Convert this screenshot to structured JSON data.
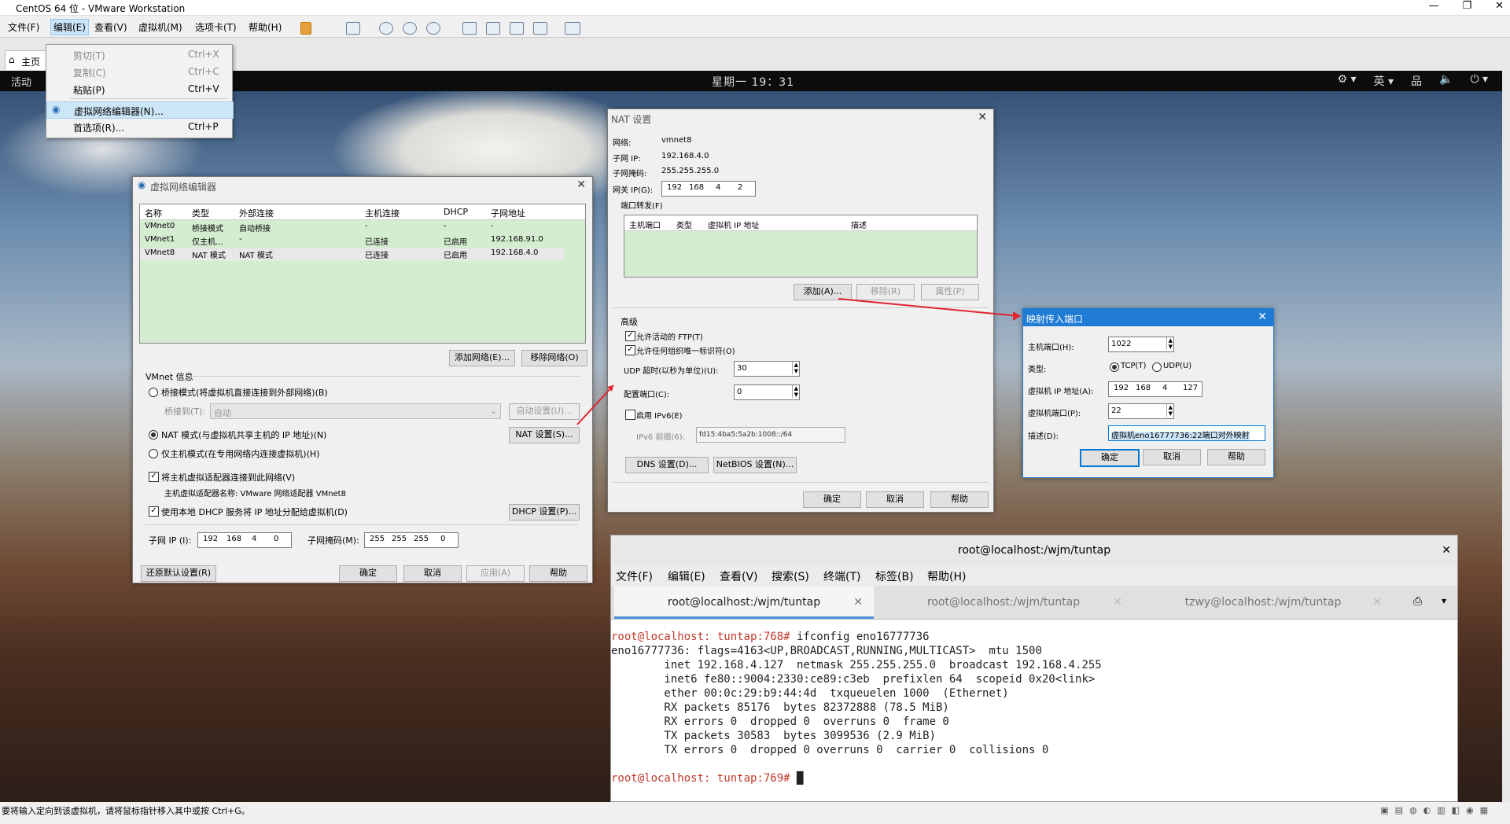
{
  "app": {
    "title": "CentOS 64 位 - VMware Workstation",
    "controls": [
      "—",
      "❐",
      "✕"
    ]
  },
  "menubar": {
    "items": [
      "文件(F)",
      "编辑(E)",
      "查看(V)",
      "虚拟机(M)",
      "选项卡(T)",
      "帮助(H)"
    ],
    "active": "编辑(E)"
  },
  "home_tab": "主页",
  "guest": {
    "activities": "活动",
    "clock": "星期一 19：31",
    "lang": "英 ▾",
    "indicators": [
      "⚙ ▾",
      "品",
      "🔈",
      "⏻ ▾"
    ]
  },
  "edit_menu": [
    {
      "label": "剪切(T)",
      "shortcut": "Ctrl+X",
      "disabled": true
    },
    {
      "label": "复制(C)",
      "shortcut": "Ctrl+C",
      "disabled": true
    },
    {
      "label": "粘贴(P)",
      "shortcut": "Ctrl+V",
      "disabled": false
    },
    {
      "label": "虚拟网络编辑器(N)...",
      "shortcut": "",
      "highlight": true
    },
    {
      "label": "首选项(R)...",
      "shortcut": "Ctrl+P",
      "disabled": false
    }
  ],
  "vne": {
    "title": "虚拟网络编辑器",
    "columns": [
      "名称",
      "类型",
      "外部连接",
      "主机连接",
      "DHCP",
      "子网地址"
    ],
    "rows": [
      [
        "VMnet0",
        "桥接模式",
        "自动桥接",
        "-",
        "-",
        "-"
      ],
      [
        "VMnet1",
        "仅主机...",
        "-",
        "已连接",
        "已启用",
        "192.168.91.0"
      ],
      [
        "VMnet8",
        "NAT 模式",
        "NAT 模式",
        "已连接",
        "已启用",
        "192.168.4.0"
      ]
    ],
    "add_network": "添加网络(E)...",
    "remove_network": "移除网络(O)",
    "info_title": "VMnet 信息",
    "bridge_mode": "桥接模式(将虚拟机直接连接到外部网络)(B)",
    "bridge_to": "桥接到(T):",
    "bridge_value": "自动",
    "auto_setting": "自动设置(U)...",
    "nat_mode": "NAT 模式(与虚拟机共享主机的 IP 地址)(N)",
    "nat_settings": "NAT 设置(S)...",
    "host_only": "仅主机模式(在专用网络内连接虚拟机)(H)",
    "connect_adapter": "将主机虚拟适配器连接到此网络(V)",
    "adapter_name": "主机虚拟适配器名称: VMware 网络适配器 VMnet8",
    "use_dhcp": "使用本地 DHCP 服务将 IP 地址分配给虚拟机(D)",
    "dhcp_settings": "DHCP 设置(P)...",
    "subnet_ip_label": "子网 IP (I):",
    "subnet_ip": [
      "192",
      "168",
      "4",
      "0"
    ],
    "mask_label": "子网掩码(M):",
    "mask": [
      "255",
      "255",
      "255",
      "0"
    ],
    "restore": "还原默认设置(R)",
    "ok": "确定",
    "cancel": "取消",
    "apply": "应用(A)",
    "help": "帮助"
  },
  "nat": {
    "title": "NAT 设置",
    "network_label": "网络:",
    "network": "vmnet8",
    "subnet_ip_label": "子网 IP:",
    "subnet_ip": "192.168.4.0",
    "mask_label": "子网掩码:",
    "mask": "255.255.255.0",
    "gateway_label": "网关 IP(G):",
    "gateway": [
      "192",
      "168",
      "4",
      "2"
    ],
    "pf_title": "端口转发(F)",
    "pf_columns": [
      "主机端口",
      "类型",
      "虚拟机 IP 地址",
      "描述"
    ],
    "add": "添加(A)...",
    "remove": "移除(R)",
    "props": "属性(P)",
    "advanced": "高级",
    "allow_ftp": "允许活动的 FTP(T)",
    "allow_oui": "允许任何组织唯一标识符(O)",
    "udp_timeout_label": "UDP 超时(以秒为单位)(U):",
    "udp_timeout": "30",
    "config_port_label": "配置端口(C):",
    "config_port": "0",
    "ipv6_enable": "启用 IPv6(E)",
    "ipv6_prefix_label": "IPv6 前缀(6):",
    "ipv6_prefix": "fd15:4ba5:5a2b:1008::/64",
    "dns": "DNS 设置(D)...",
    "netbios": "NetBIOS 设置(N)...",
    "ok": "确定",
    "cancel": "取消",
    "help": "帮助"
  },
  "map": {
    "title": "映射传入端口",
    "host_port_label": "主机端口(H):",
    "host_port": "1022",
    "type_label": "类型:",
    "tcp": "TCP(T)",
    "udp": "UDP(U)",
    "vm_ip_label": "虚拟机 IP 地址(A):",
    "vm_ip": [
      "192",
      "168",
      "4",
      "127"
    ],
    "vm_port_label": "虚拟机端口(P):",
    "vm_port": "22",
    "desc_label": "描述(D):",
    "desc": "虚拟机eno16777736:22端口对外映射",
    "ok": "确定",
    "cancel": "取消",
    "help": "帮助"
  },
  "terminal": {
    "title": "root@localhost:/wjm/tuntap",
    "menu": [
      "文件(F)",
      "编辑(E)",
      "查看(V)",
      "搜索(S)",
      "终端(T)",
      "标签(B)",
      "帮助(H)"
    ],
    "tabs": [
      "root@localhost:/wjm/tuntap",
      "root@localhost:/wjm/tuntap",
      "tzwy@localhost:/wjm/tuntap"
    ],
    "prompt1": "root@localhost: tuntap:768#",
    "cmd1": " ifconfig eno16777736",
    "lines": [
      "eno16777736: flags=4163<UP,BROADCAST,RUNNING,MULTICAST>  mtu 1500",
      "        inet 192.168.4.127  netmask 255.255.255.0  broadcast 192.168.4.255",
      "        inet6 fe80::9004:2330:ce89:c3eb  prefixlen 64  scopeid 0x20<link>",
      "        ether 00:0c:29:b9:44:4d  txqueuelen 1000  (Ethernet)",
      "        RX packets 85176  bytes 82372888 (78.5 MiB)",
      "        RX errors 0  dropped 0  overruns 0  frame 0",
      "        TX packets 30583  bytes 3099536 (2.9 MiB)",
      "        TX errors 0  dropped 0 overruns 0  carrier 0  collisions 0"
    ],
    "prompt2": "root@localhost: tuntap:769#"
  },
  "statusbar": "要将输入定向到该虚拟机，请将鼠标指针移入其中或按 Ctrl+G。"
}
